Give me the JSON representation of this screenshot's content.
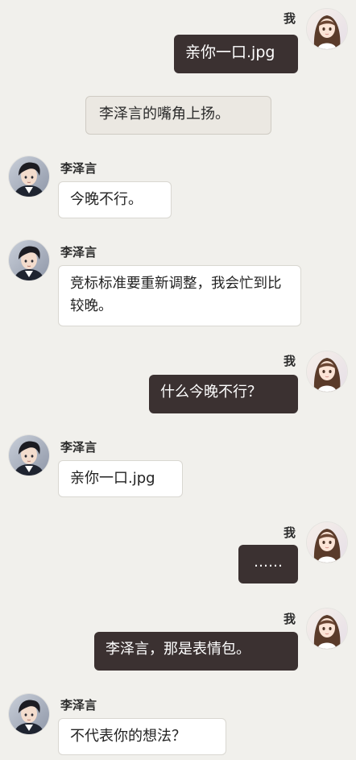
{
  "colors": {
    "background": "#f1f0ec",
    "me_bubble": "#3b3131",
    "them_bubble": "#ffffff",
    "system_bubble": "#ebe8e2"
  },
  "messages": [
    {
      "sender": "me",
      "name": "我",
      "text": "亲你一口.jpg"
    },
    {
      "sender": "system",
      "text": "李泽言的嘴角上扬。"
    },
    {
      "sender": "them",
      "name": "李泽言",
      "text": "今晚不行。"
    },
    {
      "sender": "them",
      "name": "李泽言",
      "text": "竞标标准要重新调整，我会忙到比较晚。"
    },
    {
      "sender": "me",
      "name": "我",
      "text": "什么今晚不行？"
    },
    {
      "sender": "them",
      "name": "李泽言",
      "text": "亲你一口.jpg"
    },
    {
      "sender": "me",
      "name": "我",
      "text": "……"
    },
    {
      "sender": "me",
      "name": "我",
      "text": "李泽言，那是表情包。"
    },
    {
      "sender": "them",
      "name": "李泽言",
      "text": "不代表你的想法？"
    }
  ]
}
